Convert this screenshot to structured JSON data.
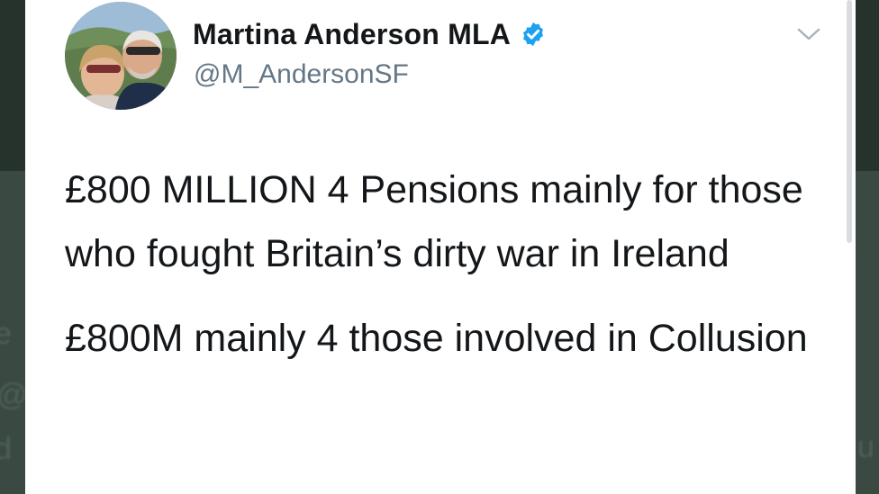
{
  "tweet": {
    "display_name": "Martina Anderson MLA",
    "handle": "@M_AndersonSF",
    "verified": true,
    "paragraphs": [
      "£800 MILLION 4 Pensions mainly for those who fought Britain’s dirty war in Ireland",
      "£800M mainly 4 those involved in Collusion"
    ]
  },
  "icons": {
    "verified": "verified-badge-icon",
    "menu": "chevron-down-icon",
    "avatar": "profile-photo"
  },
  "colors": {
    "verified_blue": "#1da1f2",
    "text": "#14171a",
    "secondary_text": "#657786",
    "card_background": "#ffffff",
    "page_background": "#26332d"
  }
}
